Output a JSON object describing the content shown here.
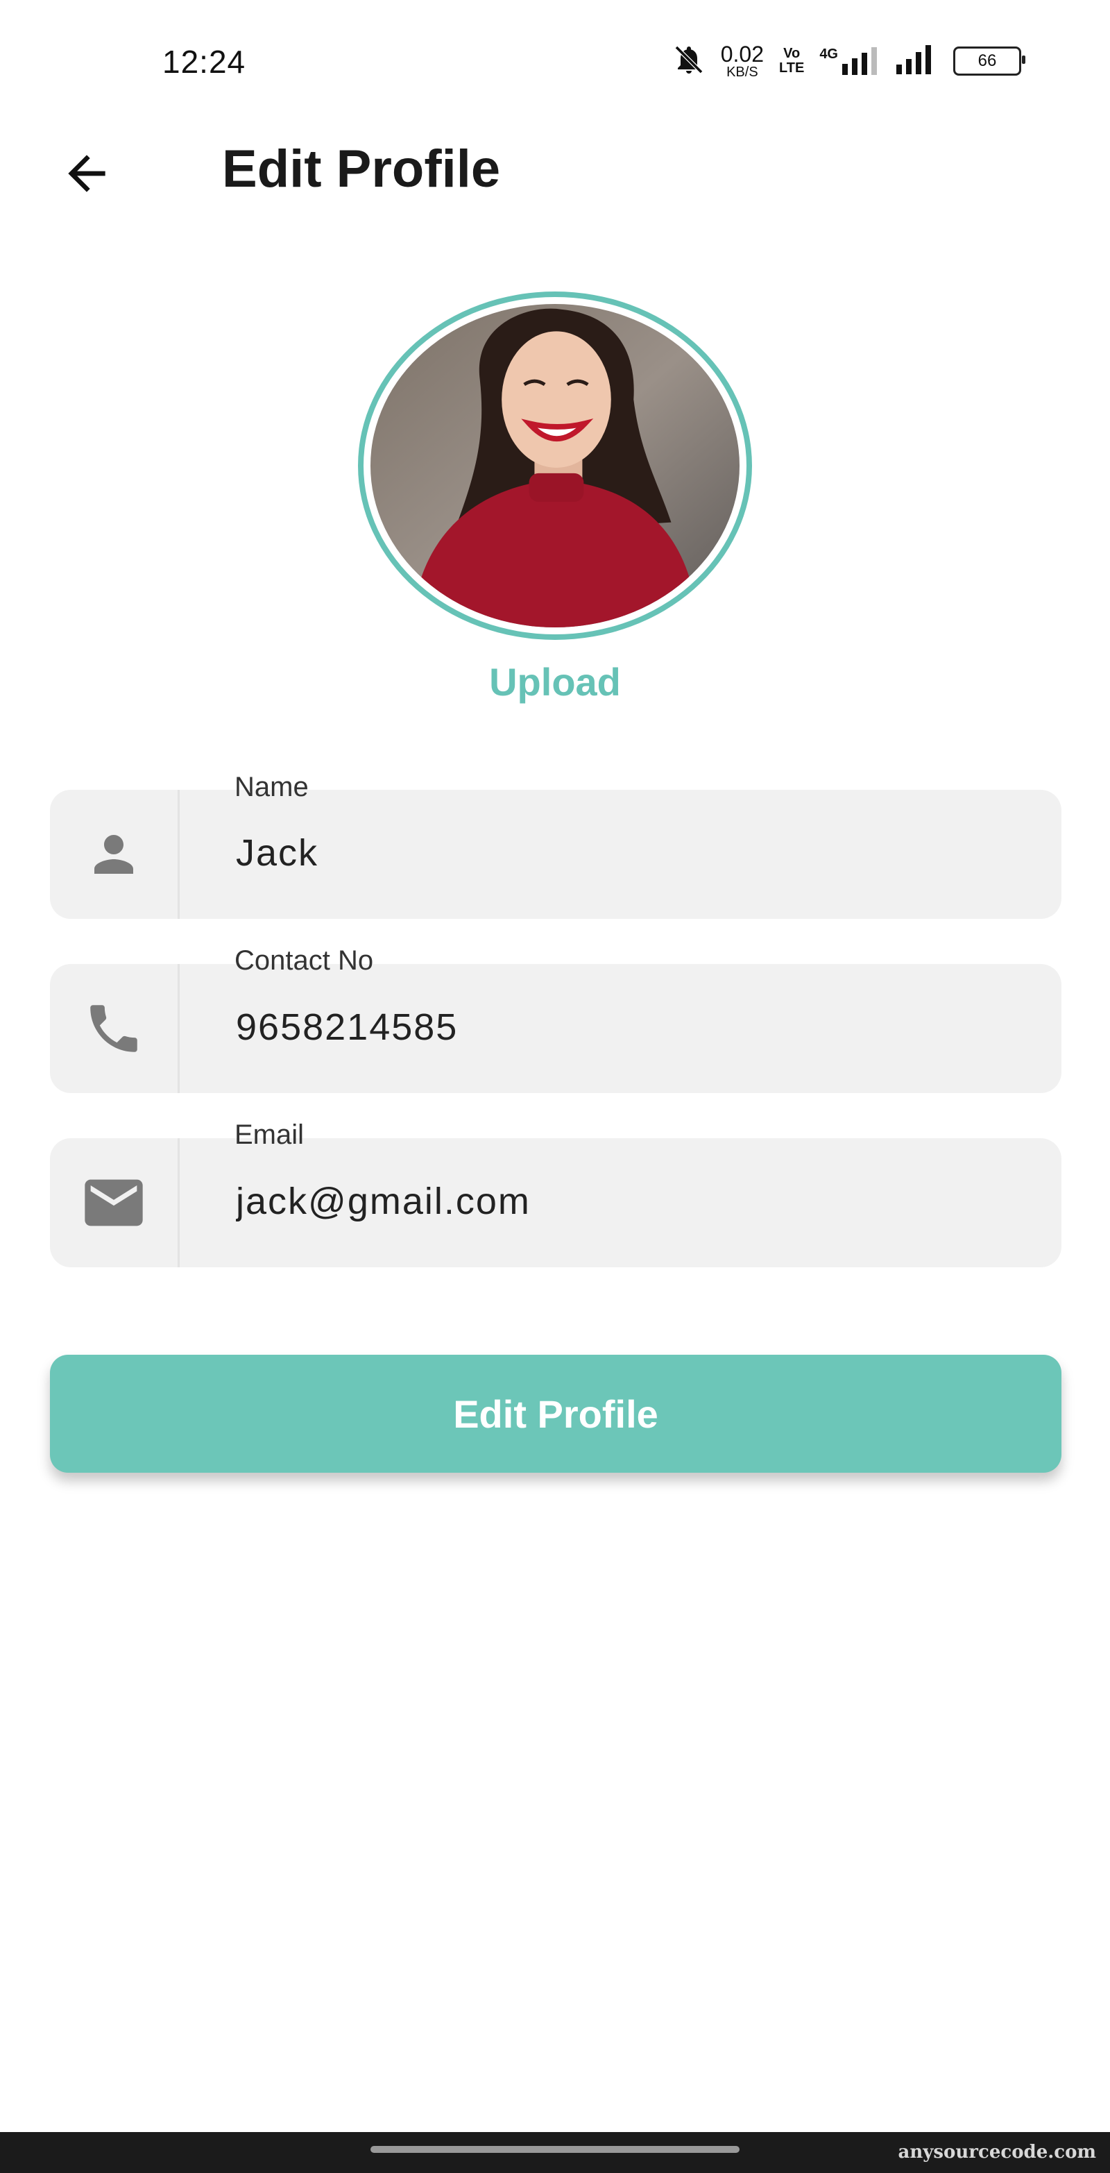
{
  "status_bar": {
    "time": "12:24",
    "net_speed_value": "0.02",
    "net_speed_unit": "KB/S",
    "volte_label_top": "Vo",
    "volte_label_bottom": "LTE",
    "network_type": "4G",
    "battery_level": "66"
  },
  "header": {
    "title": "Edit Profile",
    "back_icon": "arrow-left-icon"
  },
  "avatar": {
    "upload_label": "Upload",
    "ring_color": "#66c2b6"
  },
  "form": {
    "fields": [
      {
        "label": "Name",
        "value": "Jack",
        "icon": "person-icon"
      },
      {
        "label": "Contact No",
        "value": "9658214585",
        "icon": "phone-icon"
      },
      {
        "label": "Email",
        "value": "jack@gmail.com",
        "icon": "mail-icon"
      }
    ],
    "submit_label": "Edit Profile"
  },
  "colors": {
    "accent": "#6cc6b8",
    "field_background": "#f1f1f1",
    "icon_gray": "#7a7a7a"
  },
  "watermark": "anysourcecode.com"
}
